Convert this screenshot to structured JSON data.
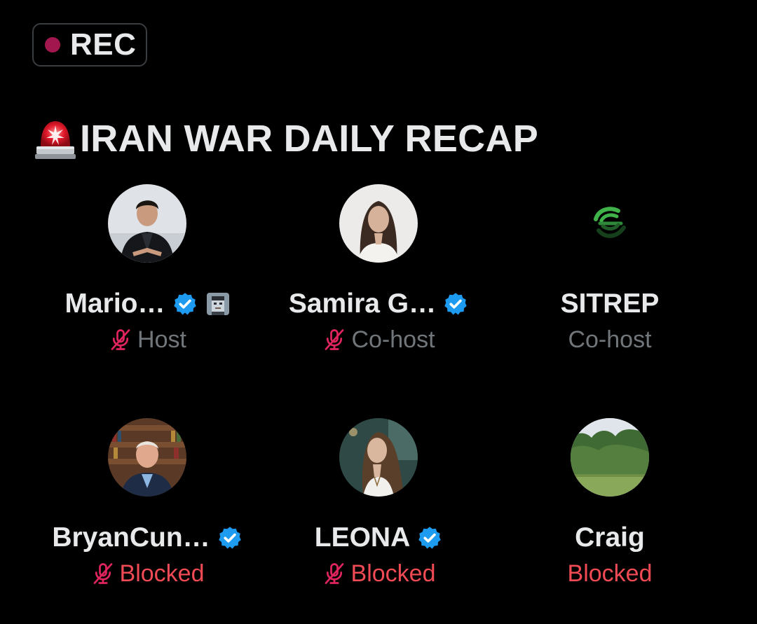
{
  "rec_badge": {
    "label": "REC",
    "dot_color": "#a3174f",
    "icon": "record-dot-icon"
  },
  "space": {
    "title": "IRAN WAR DAILY RECAP",
    "title_icon": "siren-icon"
  },
  "colors": {
    "text_primary": "#e7e9ea",
    "text_secondary": "#71767b",
    "blocked": "#f04a55",
    "muted_icon": "#e0245e",
    "verified": "#1d9bf0"
  },
  "speakers": [
    {
      "name": "Mario…",
      "role": "Host",
      "verified": true,
      "muted": true,
      "extra_badge": "pixel-avatar-icon",
      "role_color": "secondary"
    },
    {
      "name": "Samira G…",
      "role": "Co-host",
      "verified": true,
      "muted": true,
      "role_color": "secondary"
    },
    {
      "name": "SITREP",
      "role": "Co-host",
      "verified": false,
      "muted": false,
      "role_color": "secondary"
    },
    {
      "name": "BryanCun…",
      "role": "Blocked",
      "verified": true,
      "muted": true,
      "role_color": "blocked"
    },
    {
      "name": "LEONA",
      "role": "Blocked",
      "verified": true,
      "muted": true,
      "role_color": "blocked"
    },
    {
      "name": "Craig",
      "role": "Blocked",
      "verified": false,
      "muted": false,
      "role_color": "blocked"
    }
  ]
}
